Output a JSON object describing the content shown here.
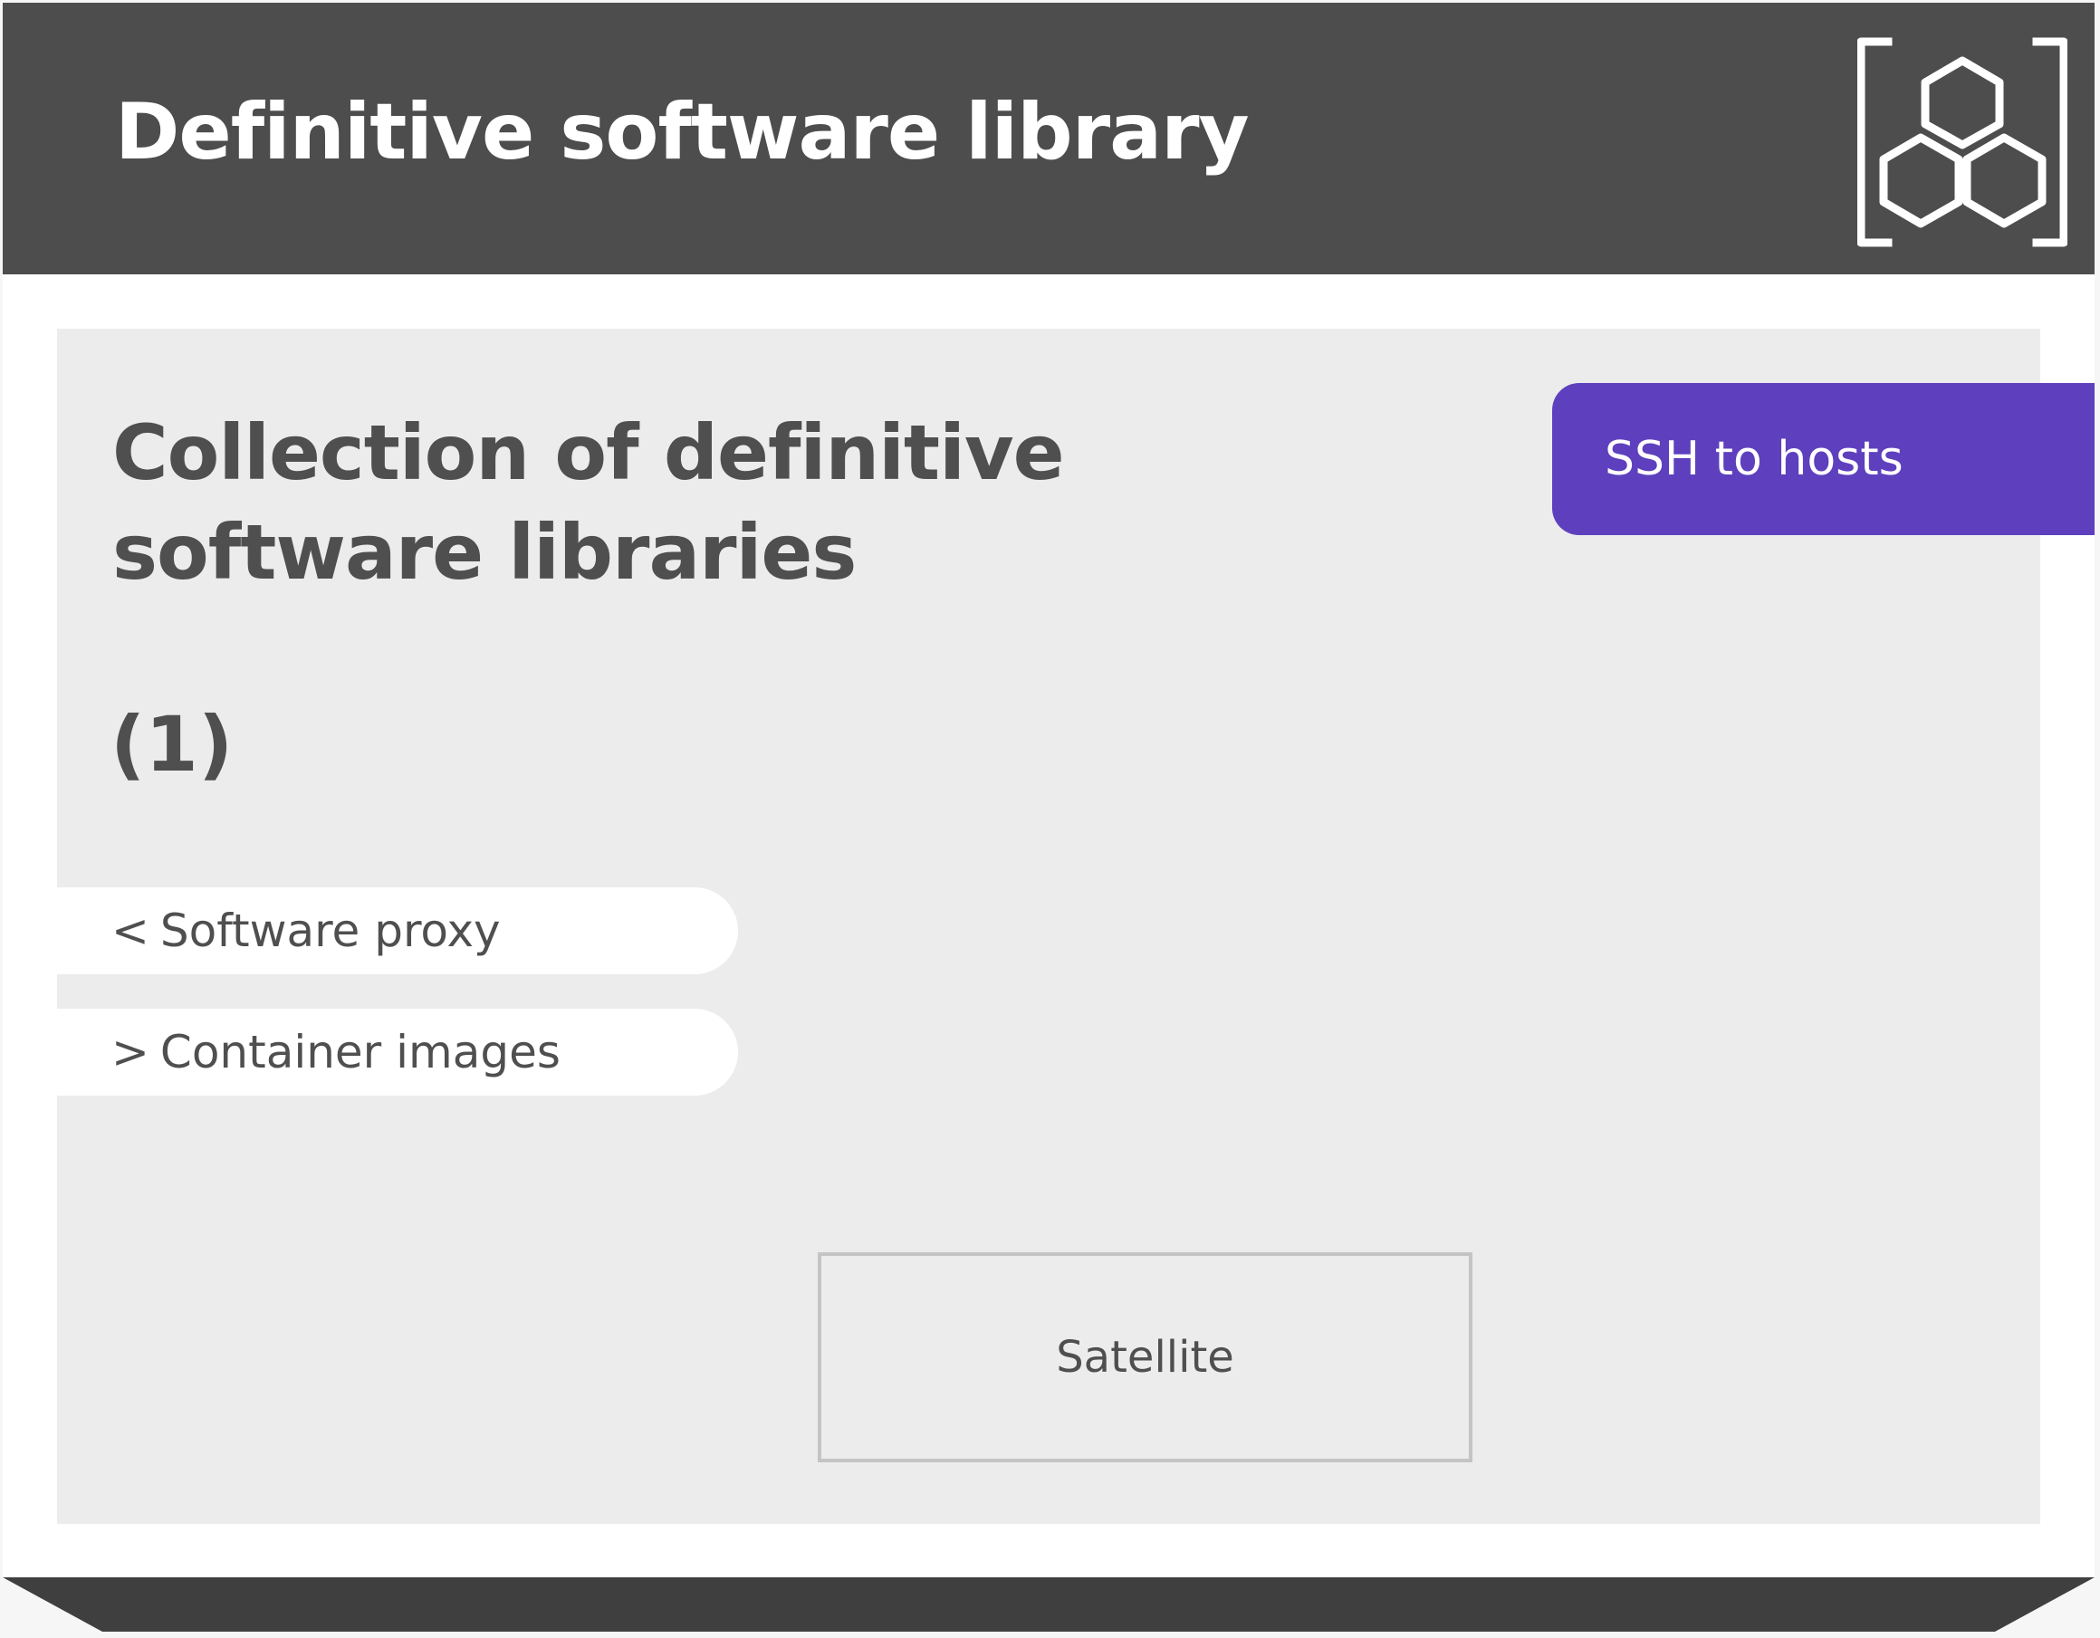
{
  "header": {
    "title": "Definitive software library",
    "icon": "hexagon-cluster-bracket-icon"
  },
  "main": {
    "title": "Collection of definitive software libraries",
    "count": "(1)"
  },
  "navigation": {
    "previous": {
      "chevron": "<",
      "label": "Software proxy"
    },
    "next": {
      "chevron": ">",
      "label": "Container images"
    }
  },
  "side_tab": {
    "label": "SSH to hosts"
  },
  "component": {
    "label": "Satellite"
  },
  "colors": {
    "header_bg": "#4d4d4d",
    "panel_bg": "#ececec",
    "accent_purple": "#5e40be",
    "text": "#4f4f4f",
    "box_border": "#c4c4c4",
    "footer": "#3f3f3f"
  }
}
